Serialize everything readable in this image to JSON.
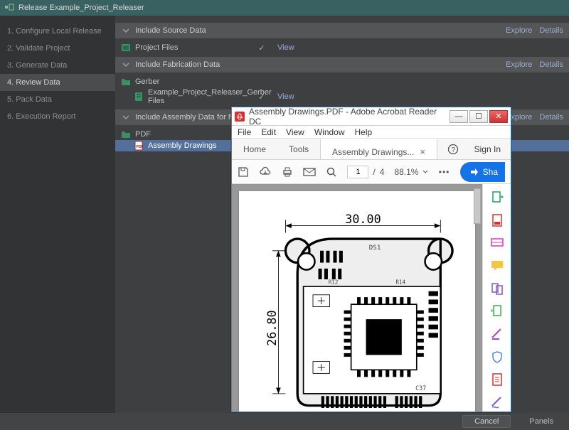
{
  "titlebar": {
    "text": "Release Example_Project_Releaser"
  },
  "sidebar": {
    "items": [
      {
        "label": "1. Configure Local Release"
      },
      {
        "label": "2. Validate Project"
      },
      {
        "label": "3. Generate Data"
      },
      {
        "label": "4. Review Data"
      },
      {
        "label": "5. Pack Data"
      },
      {
        "label": "6. Execution Report"
      }
    ],
    "active_index": 3
  },
  "sections": {
    "source": {
      "title": "Include Source Data",
      "explore": "Explore",
      "details": "Details"
    },
    "fabrication": {
      "title": "Include Fabrication Data",
      "explore": "Explore",
      "details": "Details"
    },
    "assembly": {
      "title": "Include Assembly Data for No Variant",
      "explore": "Explore",
      "details": "Details"
    }
  },
  "tree": {
    "project_files": "Project Files",
    "gerber": "Gerber",
    "gerber_file": "Example_Project_Releaser_Gerber Files",
    "pdf": "PDF",
    "assembly_drawings": "Assembly Drawings",
    "view": "View"
  },
  "footer": {
    "cancel": "Cancel",
    "panels": "Panels"
  },
  "acrobat": {
    "title": "Assembly Drawings.PDF - Adobe Acrobat Reader DC",
    "menu": {
      "file": "File",
      "edit": "Edit",
      "view": "View",
      "window": "Window",
      "help": "Help"
    },
    "tabs": {
      "home": "Home",
      "tools": "Tools",
      "doc": "Assembly Drawings...",
      "signin": "Sign In"
    },
    "pager": {
      "current": "1",
      "total": "4"
    },
    "zoom": "88.1%",
    "share": "Sha",
    "drawing": {
      "width_label": "30.00",
      "height_label": "26.80"
    }
  }
}
